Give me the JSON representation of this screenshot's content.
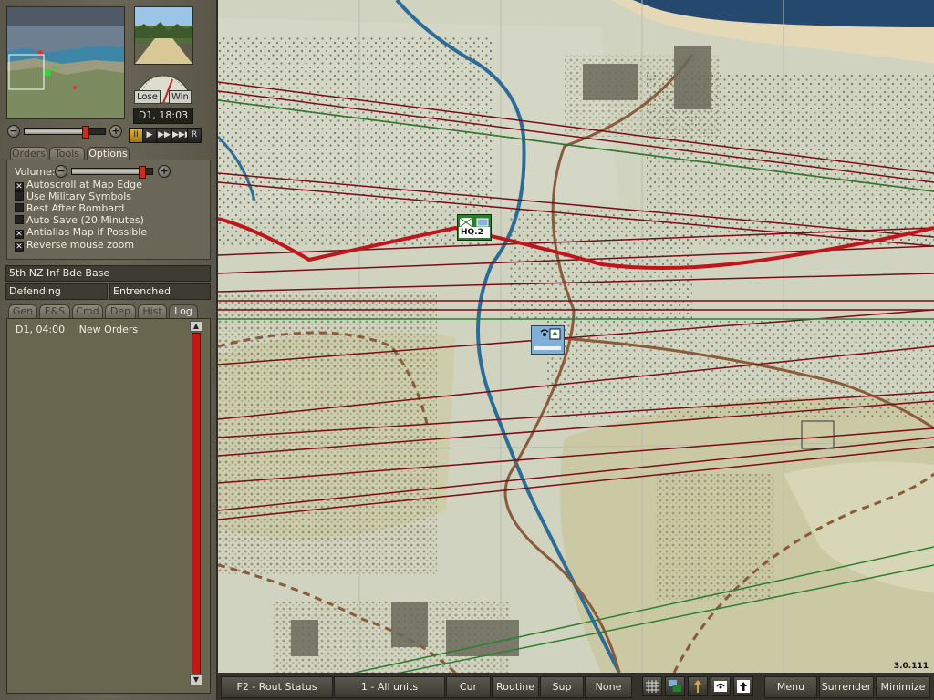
{
  "game_date": "D1, 18:03",
  "outcome_gauge": {
    "lose_label": "Lose",
    "win_label": "Win"
  },
  "zoom_level": 0.78,
  "playback": {
    "pause": "II",
    "play": "▶",
    "fast": "▶▶",
    "fastest": "▶▶▶",
    "replay": "R"
  },
  "panel_tabs": [
    "Orders",
    "Tools",
    "Options"
  ],
  "options": {
    "volume_label": "Volume:",
    "volume_level": 0.9,
    "items": [
      {
        "label": "Autoscroll at Map Edge",
        "checked": true
      },
      {
        "label": "Use Military Symbols",
        "checked": false
      },
      {
        "label": "Rest After Bombard",
        "checked": false
      },
      {
        "label": "Auto Save (20 Minutes)",
        "checked": false
      },
      {
        "label": "Antialias Map if Possible",
        "checked": true
      },
      {
        "label": "Reverse mouse zoom",
        "checked": true
      }
    ]
  },
  "unit": {
    "name": "5th NZ Inf Bde Base",
    "status": "Defending",
    "posture": "Entrenched"
  },
  "info_tabs": [
    "Gen",
    "E&S",
    "Cmd",
    "Dep",
    "Hist",
    "Log"
  ],
  "log": [
    {
      "time": "D1, 04:00",
      "message": "New Orders"
    }
  ],
  "map_units": [
    {
      "label": "HQ.2"
    }
  ],
  "bottom_bar": {
    "rout_status": "F2 - Rout Status",
    "unit_filter": "1 - All units",
    "cur": "Cur",
    "routine": "Routine",
    "sup": "Sup",
    "none": "None",
    "menu": "Menu",
    "surrender": "Surrender",
    "minimize": "Minimize"
  },
  "version": "3.0.111",
  "colors": {
    "sea": "#25486f",
    "sand": "#e3d7b6",
    "terrain": "#cfd3bf",
    "road": "#8a5a3a",
    "frontline": "#c0151b",
    "friendly_unit": "#2a7f2e",
    "allied_unit": "#7fb0d8"
  }
}
